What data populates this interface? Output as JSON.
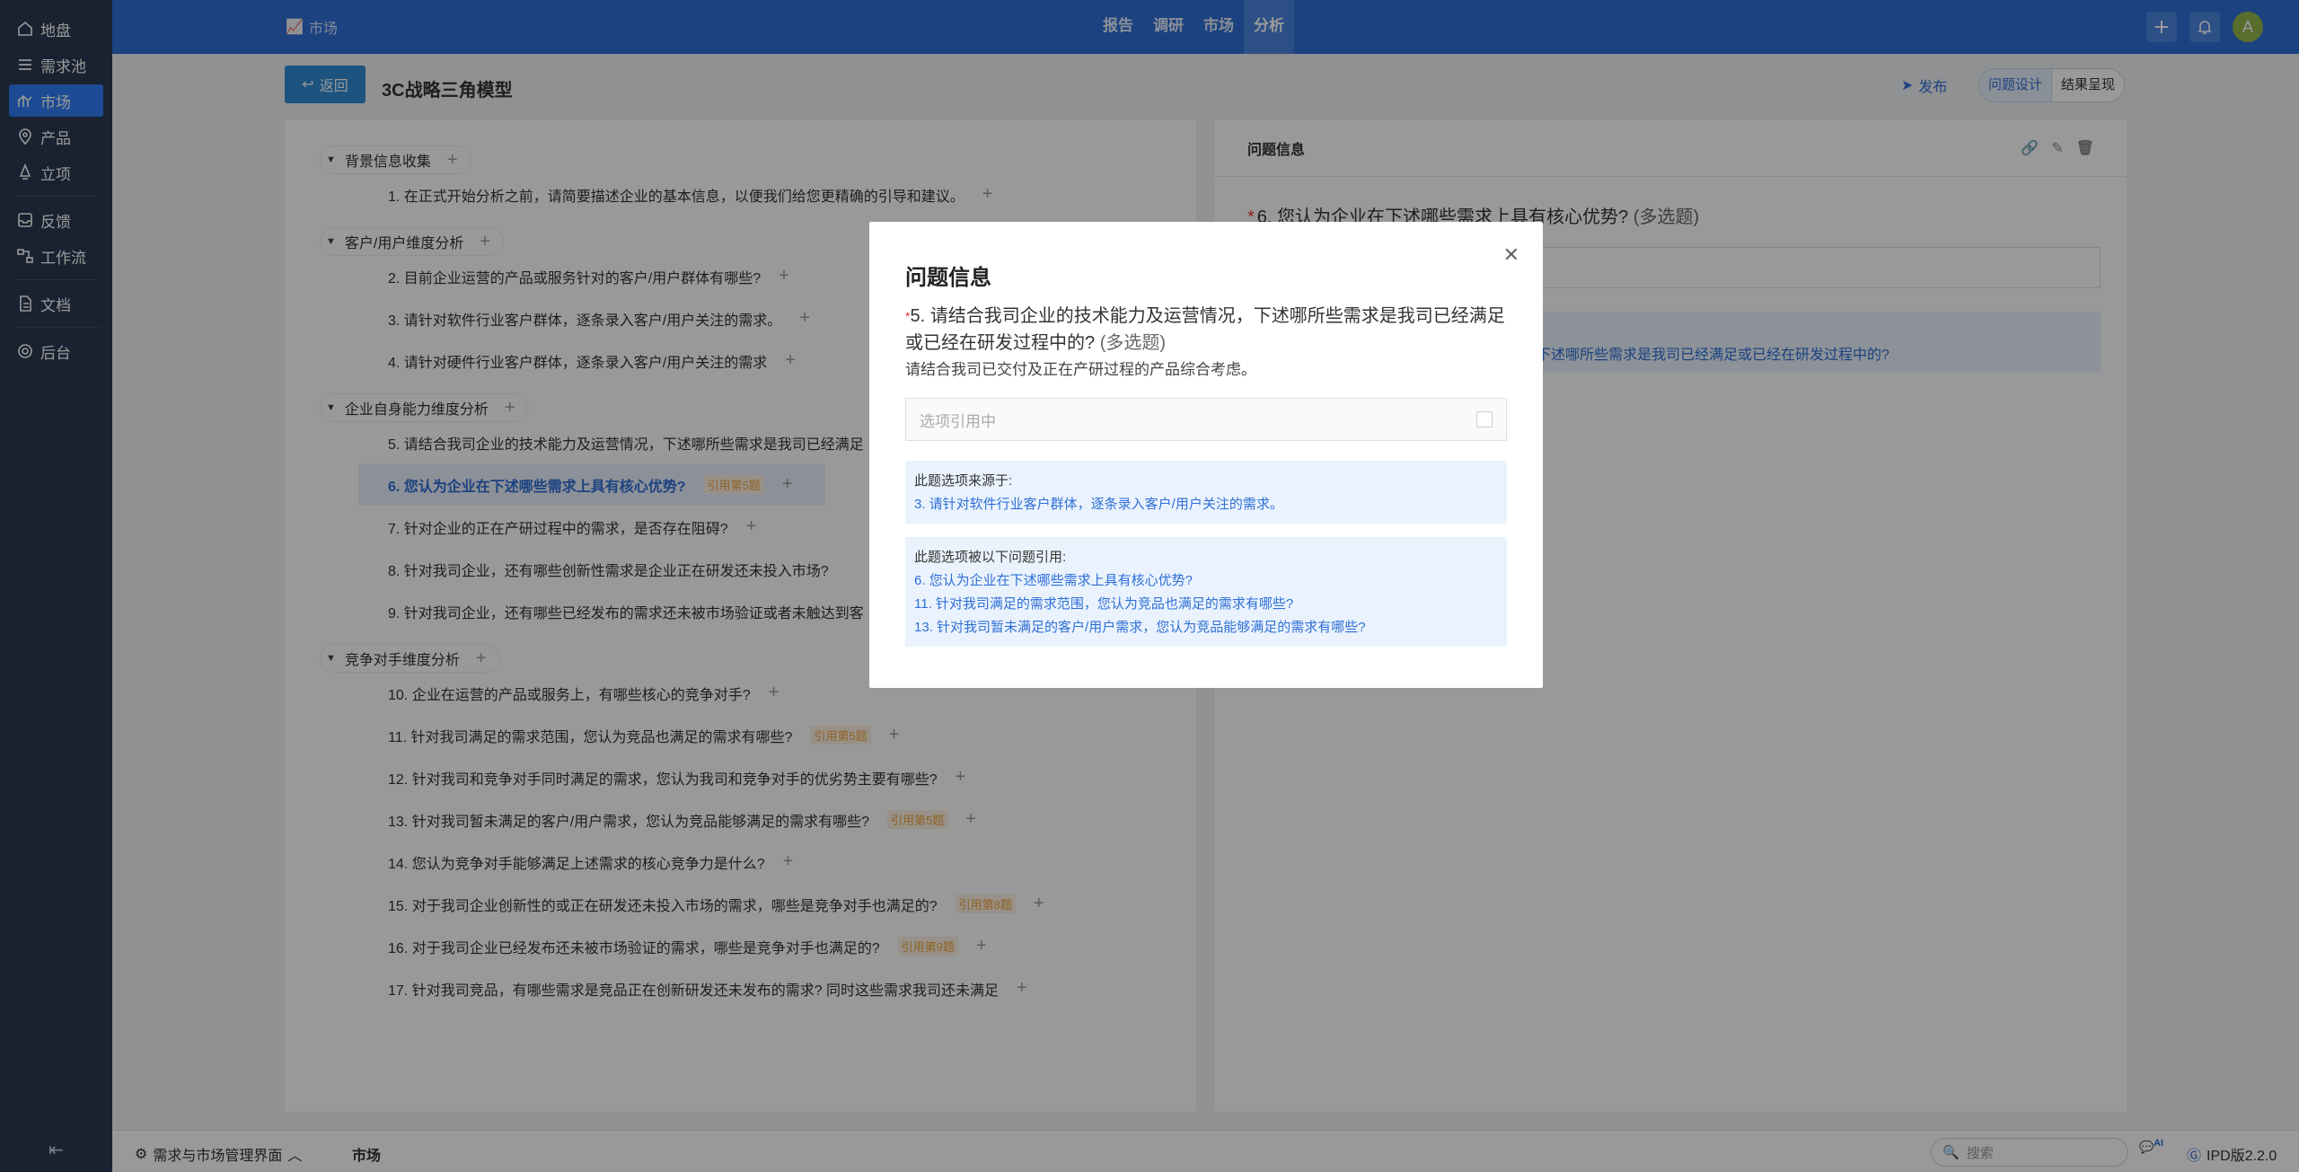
{
  "sidebar": {
    "items": [
      {
        "label": "地盘",
        "icon": "home-icon"
      },
      {
        "label": "需求池",
        "icon": "list-icon"
      },
      {
        "label": "市场",
        "icon": "chart-icon"
      },
      {
        "label": "产品",
        "icon": "location-icon"
      },
      {
        "label": "立项",
        "icon": "rocket-icon"
      },
      {
        "label": "反馈",
        "icon": "inbox-icon"
      },
      {
        "label": "工作流",
        "icon": "workflow-icon"
      },
      {
        "label": "文档",
        "icon": "document-icon"
      },
      {
        "label": "后台",
        "icon": "gear-icon"
      }
    ],
    "collapse_label": "⇤"
  },
  "topbar": {
    "breadcrumb": "市场",
    "nav": [
      "报告",
      "调研",
      "市场",
      "分析"
    ],
    "avatar": "A"
  },
  "page": {
    "back_label": "返回",
    "title": "3C战略三角模型",
    "publish_label": "发布",
    "segments": [
      "问题设计",
      "结果呈现"
    ]
  },
  "tree": {
    "groups": [
      {
        "title": "背景信息收集",
        "items": [
          {
            "text": "1. 在正式开始分析之前，请简要描述企业的基本信息，以便我们给您更精确的引导和建议。",
            "ref": ""
          }
        ]
      },
      {
        "title": "客户/用户维度分析",
        "items": [
          {
            "text": "2. 目前企业运营的产品或服务针对的客户/用户群体有哪些?",
            "ref": ""
          },
          {
            "text": "3. 请针对软件行业客户群体，逐条录入客户/用户关注的需求。",
            "ref": ""
          },
          {
            "text": "4. 请针对硬件行业客户群体，逐条录入客户/用户关注的需求",
            "ref": ""
          }
        ]
      },
      {
        "title": "企业自身能力维度分析",
        "items": [
          {
            "text": "5. 请结合我司企业的技术能力及运营情况，下述哪所些需求是我司已经满足",
            "ref": ""
          },
          {
            "text": "6. 您认为企业在下述哪些需求上具有核心优势?",
            "ref": "引用第5题"
          },
          {
            "text": "7. 针对企业的正在产研过程中的需求，是否存在阻碍?",
            "ref": ""
          },
          {
            "text": "8. 针对我司企业，还有哪些创新性需求是企业正在研发还未投入市场?",
            "ref": ""
          },
          {
            "text": "9. 针对我司企业，还有哪些已经发布的需求还未被市场验证或者未触达到客",
            "ref": ""
          }
        ]
      },
      {
        "title": "竞争对手维度分析",
        "items": [
          {
            "text": "10. 企业在运营的产品或服务上，有哪些核心的竞争对手?",
            "ref": ""
          },
          {
            "text": "11. 针对我司满足的需求范围，您认为竞品也满足的需求有哪些?",
            "ref": "引用第5题"
          },
          {
            "text": "12. 针对我司和竞争对手同时满足的需求，您认为我司和竞争对手的优劣势主要有哪些?",
            "ref": ""
          },
          {
            "text": "13. 针对我司暂未满足的客户/用户需求，您认为竞品能够满足的需求有哪些?",
            "ref": "引用第5题"
          },
          {
            "text": "14. 您认为竞争对手能够满足上述需求的核心竞争力是什么?",
            "ref": ""
          },
          {
            "text": "15. 对于我司企业创新性的或正在研发还未投入市场的需求，哪些是竞争对手也满足的?",
            "ref": "引用第8题"
          },
          {
            "text": "16. 对于我司企业已经发布还未被市场验证的需求，哪些是竞争对手也满足的?",
            "ref": "引用第9题"
          },
          {
            "text": "17. 针对我司竞品，有哪些需求是竞品正在创新研发还未发布的需求? 同时这些需求我司还未满足",
            "ref": ""
          }
        ]
      }
    ],
    "selected_index": "6"
  },
  "right_panel": {
    "header": "问题信息",
    "question_num": "6.",
    "question": "您认为企业在下述哪些需求上具有核心优势?",
    "question_tag": "(多选题)",
    "ref_text": "下述哪所些需求是我司已经满足或已经在研发过程中的?"
  },
  "modal": {
    "title": "问题信息",
    "question_num": "5.",
    "question": "请结合我司企业的技术能力及运营情况，下述哪所些需求是我司已经满足或已经在研发过程中的?",
    "question_tag": "(多选题)",
    "description": "请结合我司已交付及正在产研过程的产品综合考虑。",
    "input_placeholder": "选项引用中",
    "source_heading": "此题选项来源于:",
    "source_items": [
      "3. 请针对软件行业客户群体，逐条录入客户/用户关注的需求。"
    ],
    "referenced_heading": "此题选项被以下问题引用:",
    "referenced_items": [
      "6. 您认为企业在下述哪些需求上具有核心优势?",
      "11. 针对我司满足的需求范围，您认为竞品也满足的需求有哪些?",
      "13. 针对我司暂未满足的客户/用户需求，您认为竞品能够满足的需求有哪些?"
    ]
  },
  "bottombar": {
    "app_name": "需求与市场管理界面",
    "tab": "市场",
    "search_placeholder": "搜索",
    "ai_label": "AI",
    "version": "IPD版2.2.0"
  },
  "colors": {
    "primary": "#2f6fd6",
    "sidebar": "#2b3a52",
    "accent_ref": "#f0a33a"
  }
}
